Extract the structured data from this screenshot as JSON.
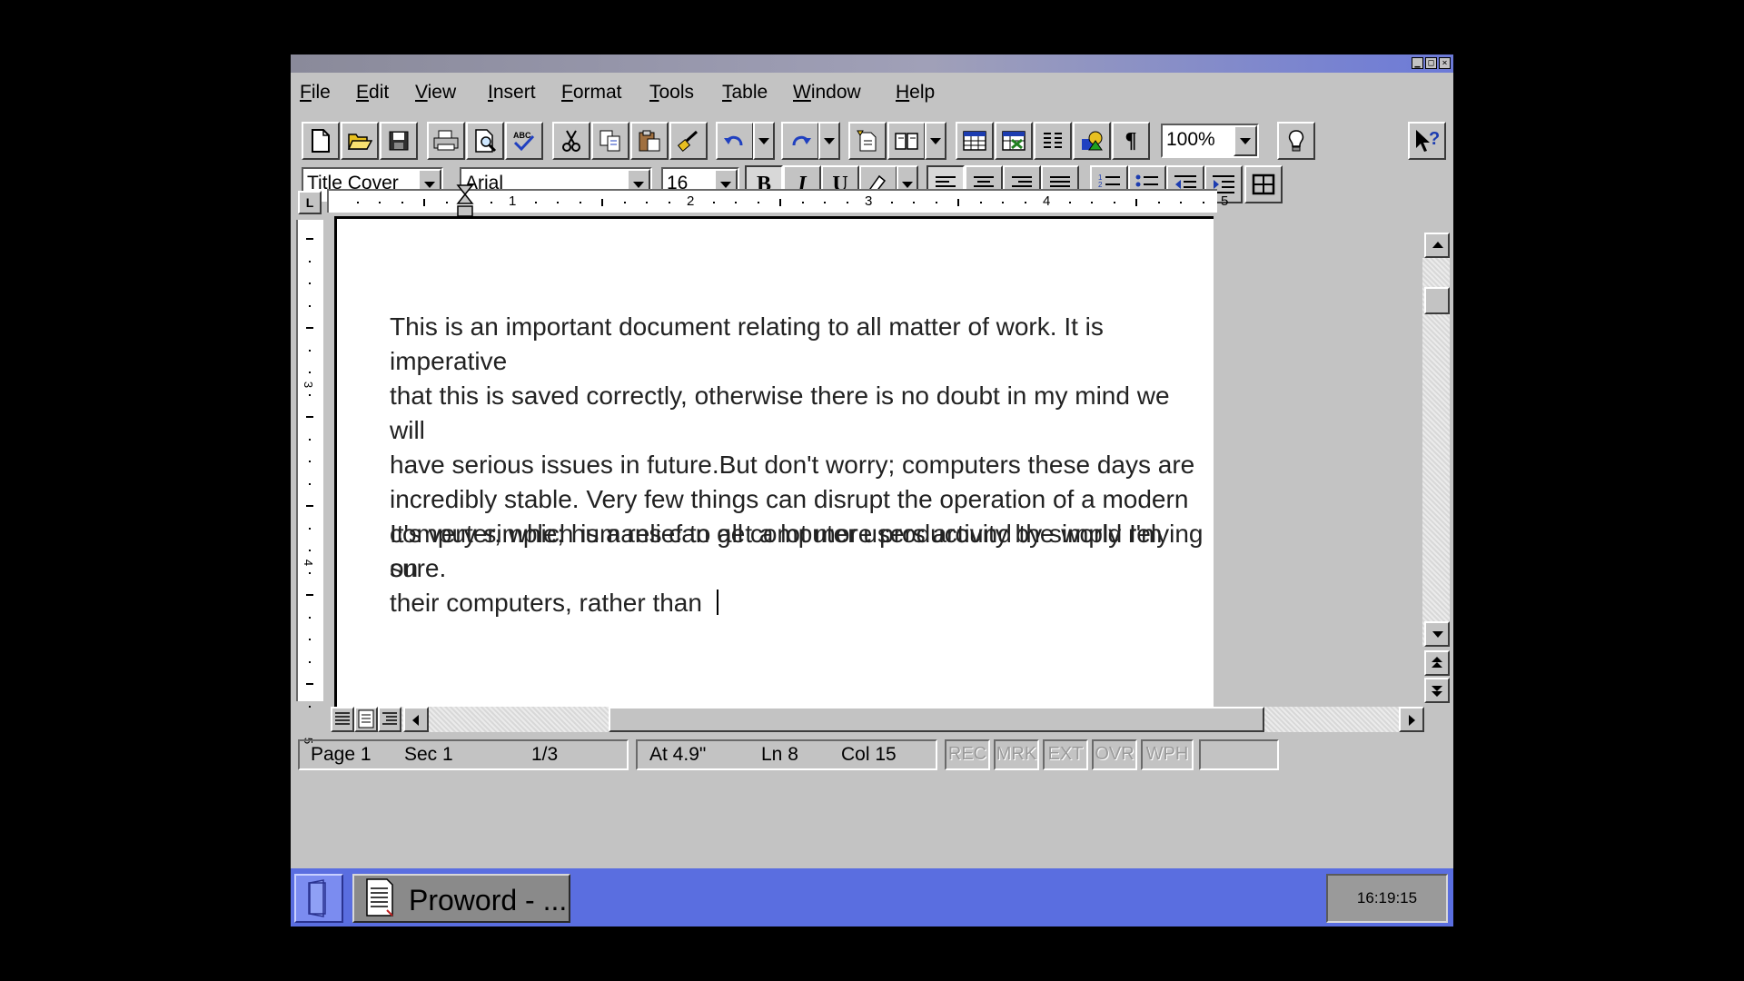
{
  "menu": [
    "File",
    "Edit",
    "View",
    "Insert",
    "Format",
    "Tools",
    "Table",
    "Window",
    "Help"
  ],
  "toolbar": {
    "zoom": "100%",
    "icons": [
      "new-document-icon",
      "open-folder-icon",
      "save-icon",
      "print-icon",
      "print-preview-icon",
      "spell-check-icon",
      "cut-icon",
      "copy-icon",
      "paste-icon",
      "format-painter-icon",
      "undo-icon",
      "redo-icon",
      "insert-address-icon",
      "insert-book-icon",
      "insert-table-icon",
      "insert-spreadsheet-icon",
      "columns-icon",
      "drawing-icon",
      "show-formatting-icon",
      "tip-bulb-icon",
      "context-help-icon"
    ]
  },
  "format": {
    "style": "Title Cover",
    "font": "Arial",
    "size": "16",
    "bold": "B",
    "italic": "I",
    "underline": "U"
  },
  "ruler": {
    "numbers": [
      "1",
      "2",
      "3",
      "4",
      "5"
    ],
    "tab_mark": "L"
  },
  "vruler": {
    "numbers": [
      "3",
      "4",
      "5"
    ]
  },
  "document": {
    "paragraph1": "This is an important document relating to all matter of work. It is imperative\nthat this is saved correctly, otherwise there is no doubt in my mind we will\nhave serious issues in future.But don't worry; computers these days are\nincredibly stable. Very few things can disrupt the operation of a modern\ncomputer, which is a relief to all computer users around the world I'm sure.",
    "paragraph2": "It's very simple; humans can get a lot more productivity by simply relying on\ntheir computers, rather than "
  },
  "status": {
    "page": "Page 1",
    "sec": "Sec 1",
    "pages": "1/3",
    "at": "At 4.9\"",
    "ln": "Ln 8",
    "col": "Col 15",
    "flags": [
      "REC",
      "MRK",
      "EXT",
      "OVR",
      "WPH"
    ]
  },
  "taskbar": {
    "task_label": "Proword - ...",
    "clock": "16:19:15"
  },
  "colors": {
    "taskbar": "#5a6ee0",
    "chrome": "#c3c3c3",
    "background": "#000000"
  }
}
